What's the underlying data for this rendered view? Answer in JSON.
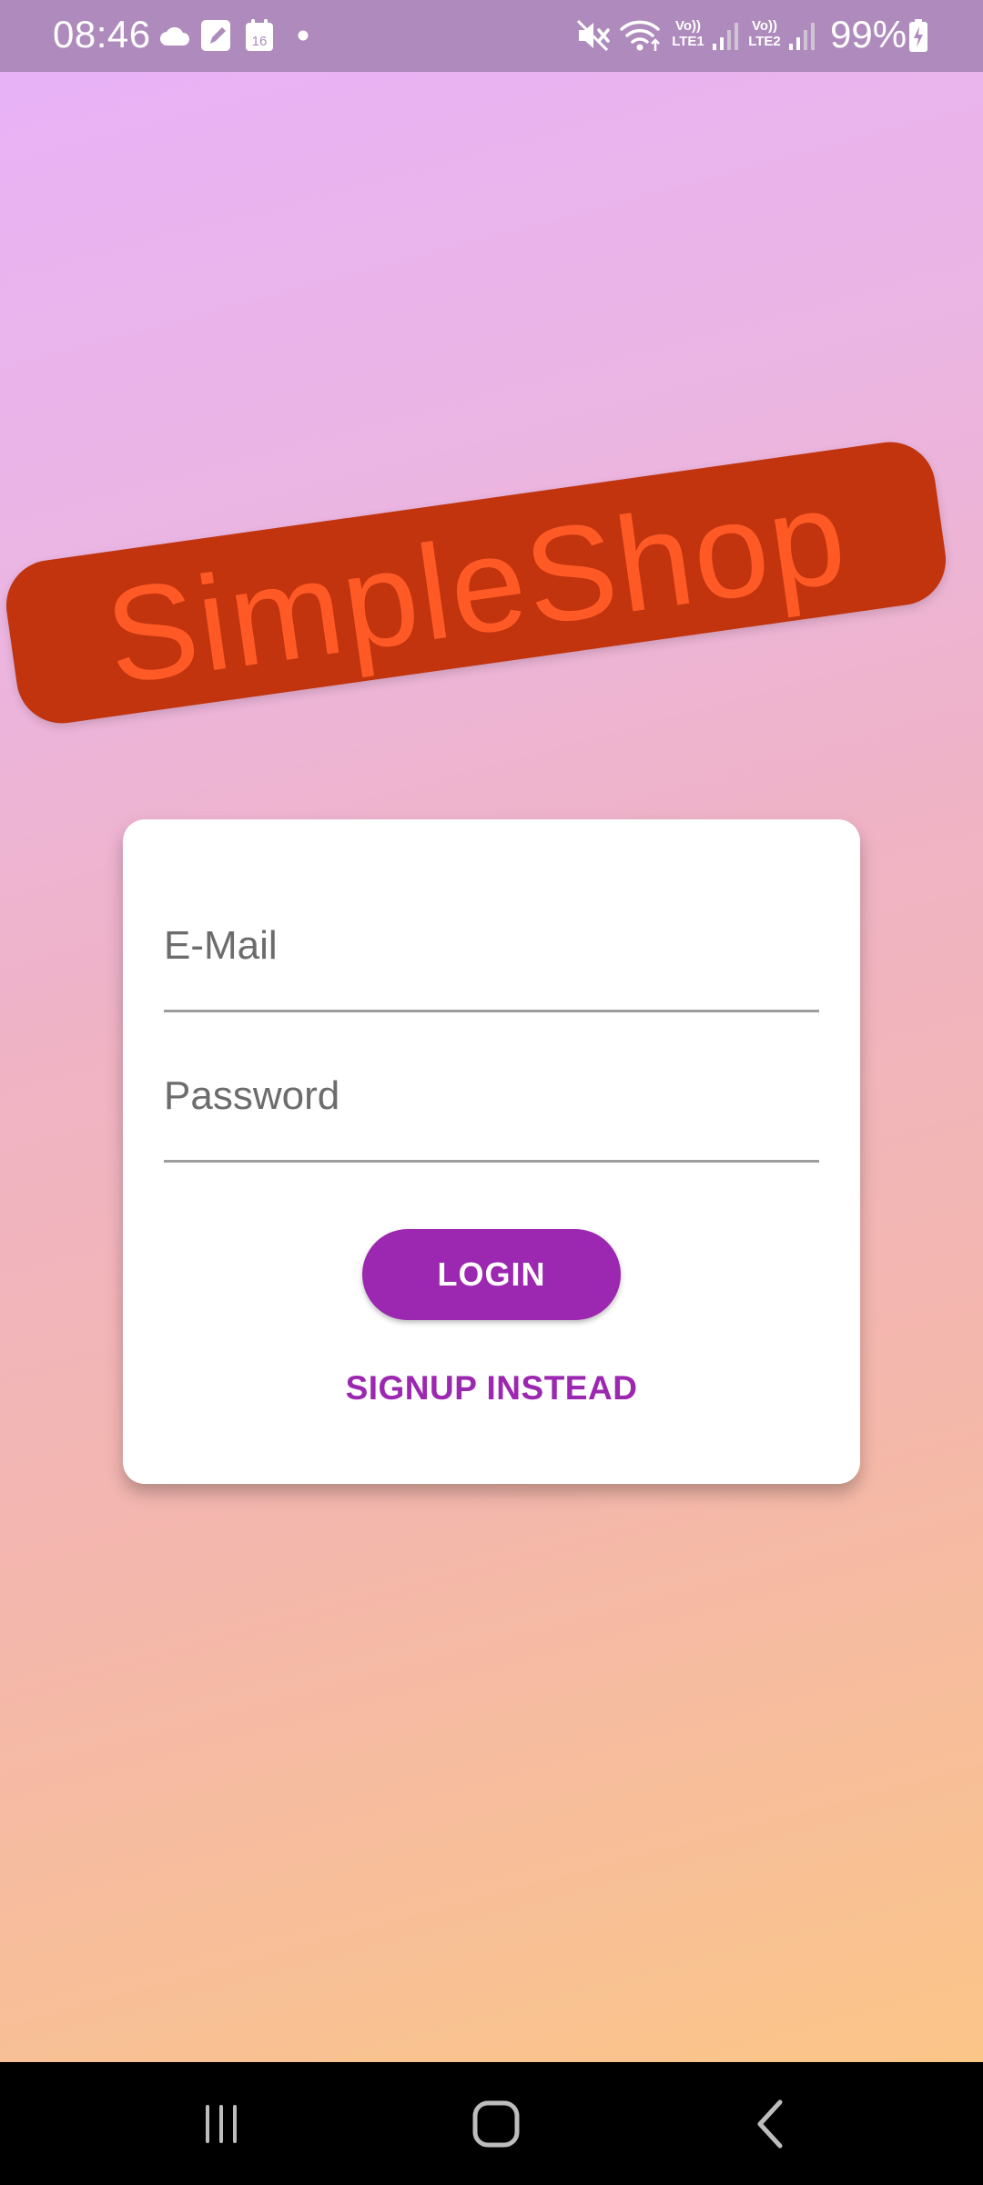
{
  "status_bar": {
    "time": "08:46",
    "battery_percent": "99%",
    "sim1_label": "Vo))\nLTE1",
    "sim2_label": "Vo))\nLTE2",
    "calendar_day": "16",
    "icons": [
      "cloud-icon",
      "notes-icon",
      "calendar-icon",
      "dot-icon",
      "mute-icon",
      "wifi-icon",
      "signal-icon",
      "battery-icon"
    ]
  },
  "app": {
    "logo_text": "SimpleShop",
    "logo_bg_color": "#c1340e",
    "logo_text_color": "#ff5a26"
  },
  "auth_form": {
    "email_placeholder": "E-Mail",
    "email_value": "",
    "password_placeholder": "Password",
    "password_value": "",
    "login_label": "LOGIN",
    "signup_label": "SIGNUP INSTEAD",
    "accent_color": "#9c27b0"
  },
  "nav_bar": {
    "items": [
      "recent-apps-icon",
      "home-icon",
      "back-icon"
    ]
  }
}
